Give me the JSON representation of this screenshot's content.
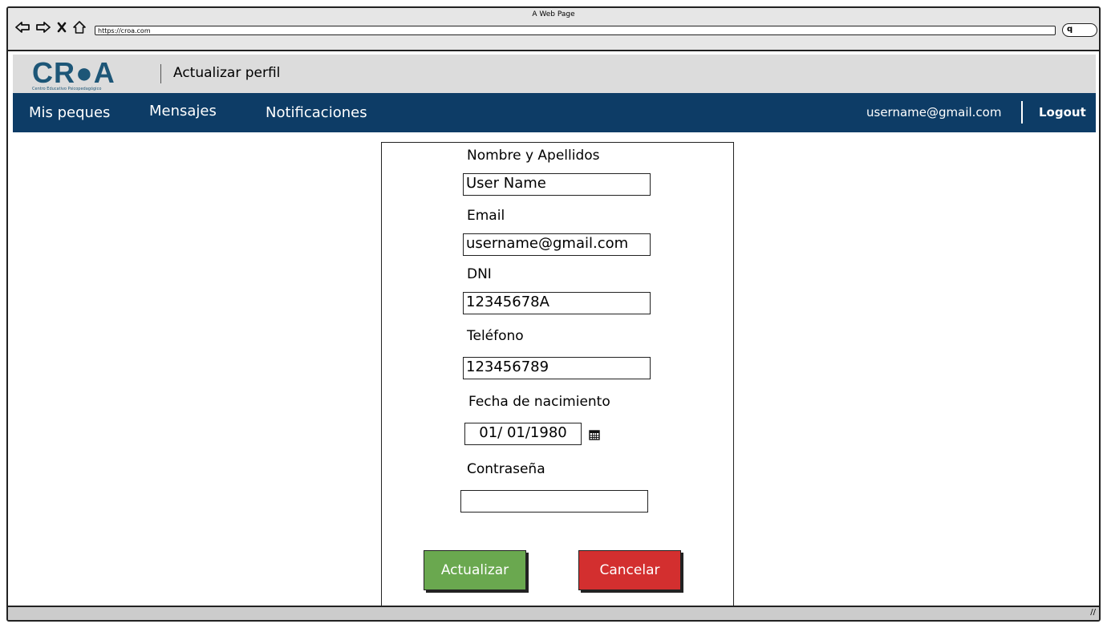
{
  "window": {
    "title": "A Web Page",
    "url": "https://croa.com",
    "search_glyph": "q"
  },
  "header": {
    "logo_text": "CR●A",
    "logo_subtitle": "Centro Educativo Psicopedagógico",
    "page_title": "Actualizar perfil"
  },
  "nav": {
    "items": [
      "Mis peques",
      "Mensajes",
      "Notificaciones"
    ],
    "user": "username@gmail.com",
    "logout": "Logout"
  },
  "form": {
    "name_label": "Nombre y Apellidos",
    "name_value": "User Name",
    "email_label": "Email",
    "email_value": "username@gmail.com",
    "dni_label": "DNI",
    "dni_value": "12345678A",
    "phone_label": "Teléfono",
    "phone_value": "123456789",
    "birth_label": "Fecha de nacimiento",
    "birth_value": "01/ 01/1980",
    "password_label": "Contraseña",
    "password_value": "",
    "update_button": "Actualizar",
    "cancel_button": "Cancelar"
  },
  "colors": {
    "navbar": "#0d3c66",
    "brand": "#1d5677",
    "update": "#6aa84f",
    "cancel": "#d32f2f"
  },
  "icons": [
    "back-arrow-icon",
    "forward-arrow-icon",
    "close-icon",
    "home-icon",
    "search-icon",
    "calendar-icon",
    "resize-grip-icon"
  ]
}
